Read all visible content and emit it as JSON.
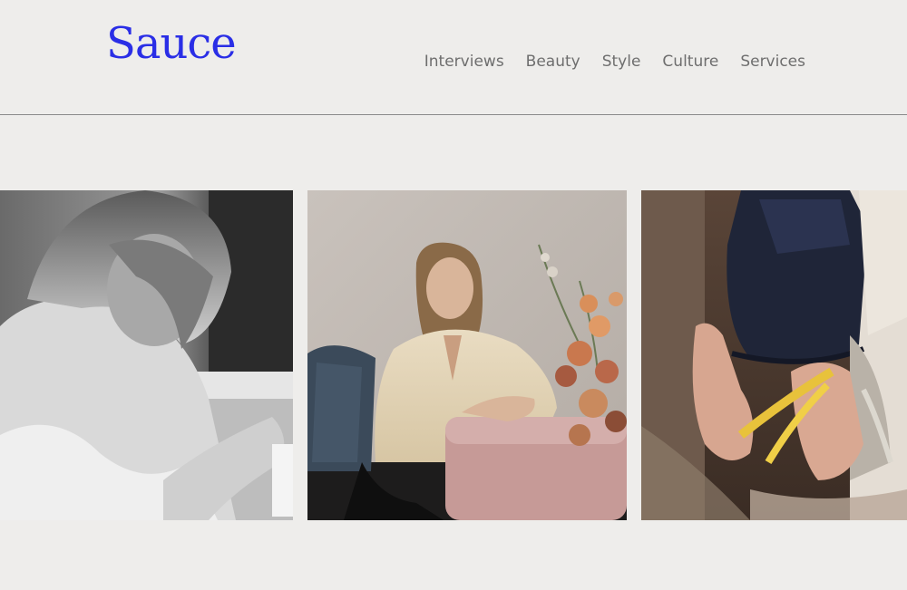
{
  "brand": {
    "logo_text": "Sauce",
    "color": "#2a2ee6"
  },
  "nav": {
    "items": [
      {
        "label": "Interviews"
      },
      {
        "label": "Beauty"
      },
      {
        "label": "Style"
      },
      {
        "label": "Culture"
      },
      {
        "label": "Services"
      }
    ]
  },
  "gallery": {
    "images": [
      {
        "subject": "woman-sewing-black-and-white-photo"
      },
      {
        "subject": "woman-seated-on-pink-sofa-photo"
      },
      {
        "subject": "hands-measuring-garment-on-mannequin-photo"
      }
    ]
  }
}
